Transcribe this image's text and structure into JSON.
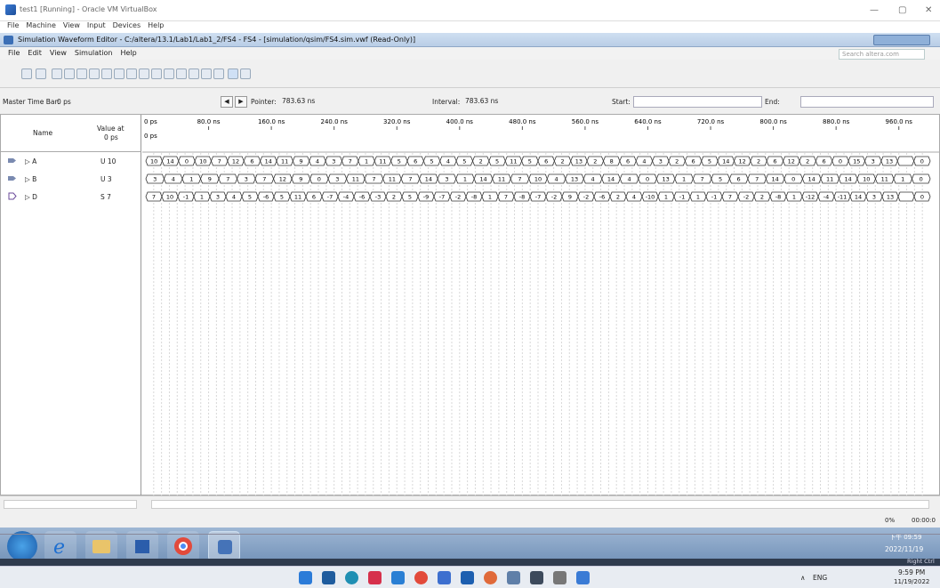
{
  "vbox": {
    "title": "test1 [Running] - Oracle VM VirtualBox",
    "menu": [
      "File",
      "Machine",
      "View",
      "Input",
      "Devices",
      "Help"
    ],
    "min": "—",
    "max": "▢",
    "close": "✕"
  },
  "quartus": {
    "title": "Simulation Waveform Editor - C:/altera/13.1/Lab1/Lab1_2/FS4 - FS4 - [simulation/qsim/FS4.sim.vwf (Read-Only)]",
    "menu": [
      "File",
      "Edit",
      "View",
      "Simulation",
      "Help"
    ],
    "search_placeholder": "Search altera.com"
  },
  "timebar": {
    "master_label": "Master Time Bar:",
    "master_value": "0 ps",
    "pointer_label": "Pointer:",
    "pointer_value": "783.63 ns",
    "interval_label": "Interval:",
    "interval_value": "783.63 ns",
    "start_label": "Start:",
    "start_value": "",
    "end_label": "End:",
    "end_value": ""
  },
  "header": {
    "name": "Name",
    "value_at": "Value at",
    "value_at_time": "0 ps",
    "time_origin": "0 ps",
    "time_origin2": "0 ps"
  },
  "time_ticks": [
    "80.0 ns",
    "160.0 ns",
    "240.0 ns",
    "320.0 ns",
    "400.0 ns",
    "480.0 ns",
    "560.0 ns",
    "640.0 ns",
    "720.0 ns",
    "800.0 ns",
    "880.0 ns",
    "960.0 ns"
  ],
  "signals": [
    {
      "name": "A",
      "value": "U 10",
      "icon": "input-pin-icon",
      "values": [
        "10",
        "14",
        "0",
        "10",
        "7",
        "12",
        "6",
        "14",
        "11",
        "9",
        "4",
        "3",
        "7",
        "1",
        "11",
        "5",
        "6",
        "5",
        "4",
        "5",
        "2",
        "5",
        "11",
        "5",
        "6",
        "2",
        "13",
        "2",
        "8",
        "6",
        "4",
        "3",
        "2",
        "6",
        "5",
        "14",
        "12",
        "2",
        "6",
        "12",
        "2",
        "6",
        "0",
        "15",
        "3",
        "13",
        "",
        "0"
      ]
    },
    {
      "name": "B",
      "value": "U 3",
      "icon": "input-pin-icon",
      "values": [
        "3",
        "4",
        "1",
        "9",
        "7",
        "3",
        "7",
        "12",
        "9",
        "0",
        "3",
        "11",
        "7",
        "11",
        "7",
        "14",
        "3",
        "1",
        "14",
        "11",
        "7",
        "10",
        "4",
        "13",
        "4",
        "14",
        "4",
        "0",
        "13",
        "1",
        "7",
        "5",
        "6",
        "7",
        "14",
        "0",
        "14",
        "11",
        "14",
        "10",
        "11",
        "1",
        "0"
      ]
    },
    {
      "name": "D",
      "value": "S 7",
      "icon": "output-pin-icon",
      "values": [
        "7",
        "10",
        "-1",
        "1",
        "3",
        "4",
        "5",
        "-6",
        "5",
        "11",
        "6",
        "-7",
        "-4",
        "-6",
        "-3",
        "2",
        "5",
        "-9",
        "-7",
        "-2",
        "-8",
        "1",
        "7",
        "-8",
        "-7",
        "-2",
        "9",
        "-2",
        "-6",
        "2",
        "4",
        "-10",
        "1",
        "-1",
        "1",
        "-1",
        "7",
        "-2",
        "2",
        "-8",
        "1",
        "-12",
        "-4",
        "-11",
        "14",
        "3",
        "13",
        "",
        "0"
      ]
    }
  ],
  "status": {
    "percent": "0%",
    "elapsed": "00:00:0"
  },
  "guest_tray": {
    "time": "下午 09:59",
    "date": "2022/11/19",
    "right_ctrl": "Right Ctrl"
  },
  "host_tray": {
    "lang": "ENG",
    "time": "9:59 PM",
    "date": "11/19/2022"
  }
}
